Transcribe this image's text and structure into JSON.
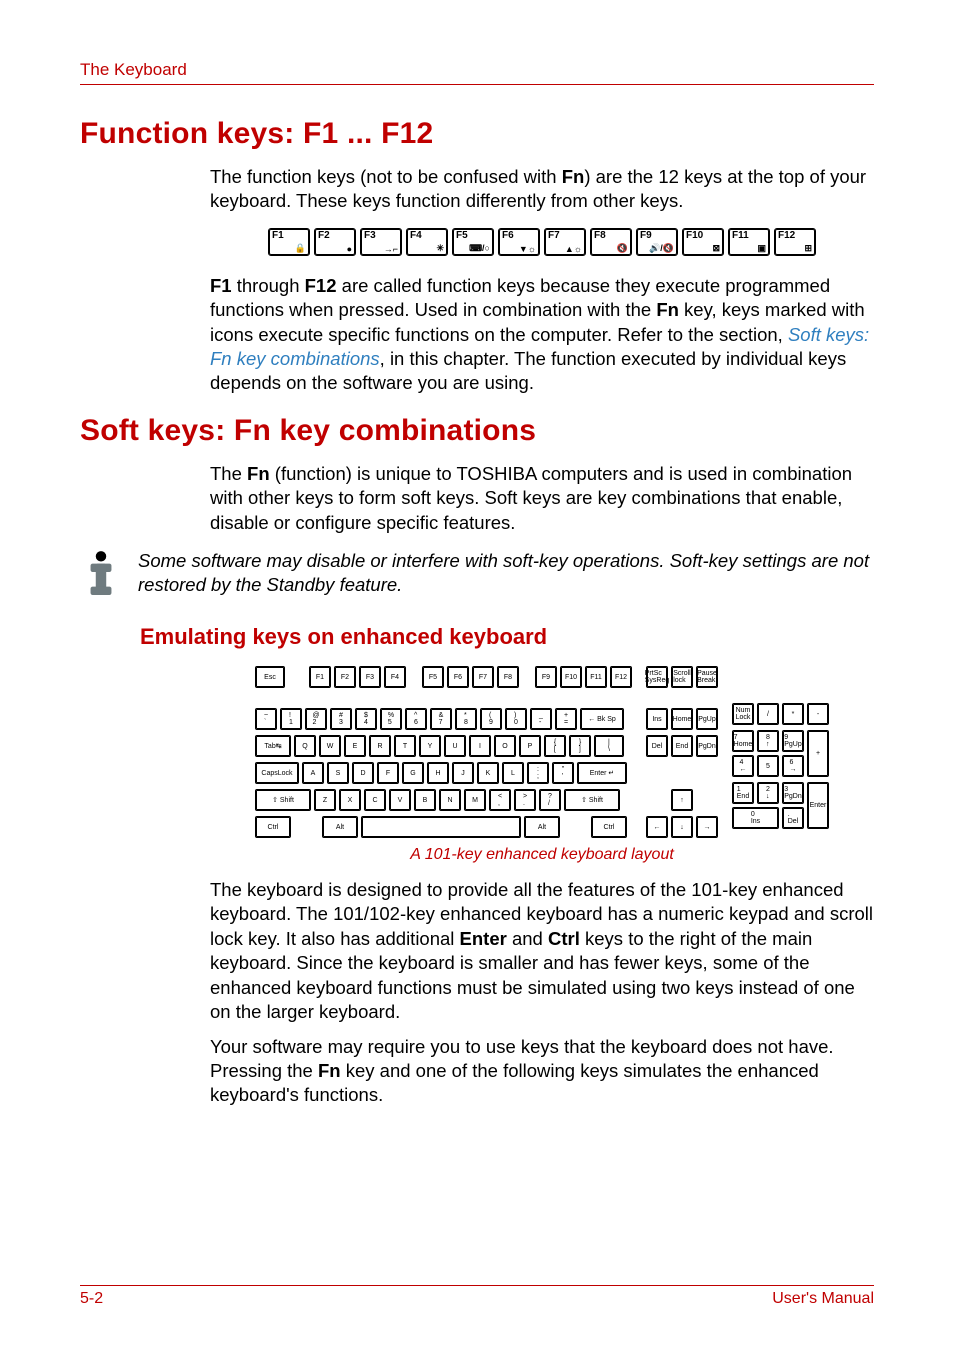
{
  "running_head": "The Keyboard",
  "h1_a": "Function keys: F1 ... F12",
  "p1_a": "The function keys (not to be confused with ",
  "p1_b": "Fn",
  "p1_c": ") are the 12 keys at the top of your keyboard. These keys function differently from other keys.",
  "fkeys": [
    "F1",
    "F2",
    "F3",
    "F4",
    "F5",
    "F6",
    "F7",
    "F8",
    "F9",
    "F10",
    "F11",
    "F12"
  ],
  "fglyphs": [
    "🔒",
    "●",
    "→⌐",
    "✳",
    "⌨/○",
    "▼☼",
    "▲☼",
    "🔇",
    "🔊/🔇",
    "⊠",
    "▣",
    "⊞"
  ],
  "p2_a": "F1",
  "p2_b": " through ",
  "p2_c": "F12",
  "p2_d": " are called function keys because they execute programmed functions when pressed. Used in combination with the ",
  "p2_e": "Fn",
  "p2_f": " key, keys marked with icons execute specific functions on the computer. Refer to the section, ",
  "p2_link": "Soft keys: Fn key combinations",
  "p2_g": ", in this chapter. The function executed by individual keys depends on the software you are using.",
  "h1_b": "Soft keys: Fn key combinations",
  "p3_a": "The ",
  "p3_b": "Fn",
  "p3_c": " (function) is unique to TOSHIBA computers and is used in combination with other keys to form soft keys. Soft keys are key combinations that enable, disable or configure specific features.",
  "note": "Some software may disable or interfere with soft-key operations. Soft-key settings are not restored by the Standby feature.",
  "h2": "Emulating keys on enhanced keyboard",
  "kb": {
    "top": [
      "Esc",
      "F1",
      "F2",
      "F3",
      "F4",
      "F5",
      "F6",
      "F7",
      "F8",
      "F9",
      "F10",
      "F11",
      "F12"
    ],
    "r1": [
      "~\n`",
      "!\n1",
      "@\n2",
      "#\n3",
      "$\n4",
      "%\n5",
      "^\n6",
      "&\n7",
      "*\n8",
      "(\n9",
      ")\n0",
      "_\n-",
      "+\n=",
      "← Bk Sp"
    ],
    "r2": [
      "Tab↹",
      "Q",
      "W",
      "E",
      "R",
      "T",
      "Y",
      "U",
      "I",
      "O",
      "P",
      "{\n[",
      "}\n]",
      "|\n\\"
    ],
    "r3": [
      "CapsLock",
      "A",
      "S",
      "D",
      "F",
      "G",
      "H",
      "J",
      "K",
      "L",
      ":\n;",
      "\"\n'",
      "Enter ↵"
    ],
    "r4": [
      "⇧ Shift",
      "Z",
      "X",
      "C",
      "V",
      "B",
      "N",
      "M",
      "<\n,",
      ">\n.",
      "?\n/",
      "⇧ Shift"
    ],
    "r5": [
      "Ctrl",
      "Alt",
      "",
      "Alt",
      "Ctrl"
    ],
    "nav_top": [
      "PrtSc\nSysReq",
      "Scroll\nlock",
      "Pause\nBreak"
    ],
    "nav1": [
      "Ins",
      "Home",
      "PgUp"
    ],
    "nav2": [
      "Del",
      "End",
      "PgDn"
    ],
    "arr1": [
      "↑"
    ],
    "arr2": [
      "←",
      "↓",
      "→"
    ],
    "np_top": [
      "Num\nLock",
      "/",
      "*",
      "-"
    ],
    "np1": [
      "7\nHome",
      "8\n↑",
      "9\nPgUp"
    ],
    "np2": [
      "4\n←",
      "5",
      "6\n→"
    ],
    "np3": [
      "1\nEnd",
      "2\n↓",
      "3\nPgDn"
    ],
    "np4": [
      "0\nIns",
      ".\nDel"
    ],
    "np_plus": "+",
    "np_enter": "Enter"
  },
  "caption": "A 101-key enhanced keyboard layout",
  "p4_a": "The keyboard is designed to provide all the features of the 101-key enhanced keyboard. The 101/102-key enhanced keyboard has a numeric keypad and scroll lock key. It also has additional ",
  "p4_b": "Enter",
  "p4_c": " and ",
  "p4_d": "Ctrl",
  "p4_e": " keys to the right of the main keyboard. Since the keyboard is smaller and has fewer keys, some of the enhanced keyboard functions must be simulated using two keys instead of one on the larger keyboard.",
  "p5_a": "Your software may require you to use keys that the keyboard does not have. Pressing the ",
  "p5_b": "Fn",
  "p5_c": " key and one of the following keys simulates the enhanced keyboard's functions.",
  "footer_left": "5-2",
  "footer_right": "User's Manual"
}
